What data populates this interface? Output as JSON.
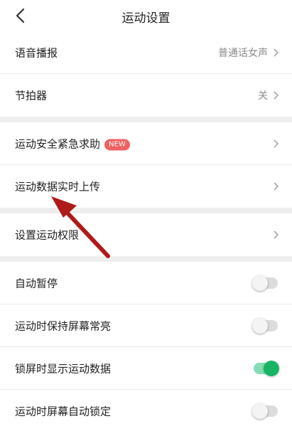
{
  "header": {
    "title": "运动设置",
    "back_icon": "chevron-left-icon"
  },
  "colors": {
    "toggle_on": "#18b465",
    "badge": "#f06060",
    "annotation_arrow": "#b01a1a"
  },
  "group1": {
    "voice": {
      "label": "语音播报",
      "value": "普通话女声"
    },
    "metronome": {
      "label": "节拍器",
      "value": "关"
    }
  },
  "group2": {
    "emergency": {
      "label": "运动安全紧急求助",
      "badge": "NEW"
    },
    "upload": {
      "label": "运动数据实时上传"
    }
  },
  "group3": {
    "permissions": {
      "label": "设置运动权限"
    }
  },
  "group4": {
    "auto_pause": {
      "label": "自动暂停",
      "on": false
    },
    "keep_screen_on": {
      "label": "运动时保持屏幕常亮",
      "on": false
    },
    "lockscreen_data": {
      "label": "锁屏时显示运动数据",
      "on": true
    },
    "auto_lock": {
      "label": "运动时屏幕自动锁定",
      "on": false
    }
  }
}
